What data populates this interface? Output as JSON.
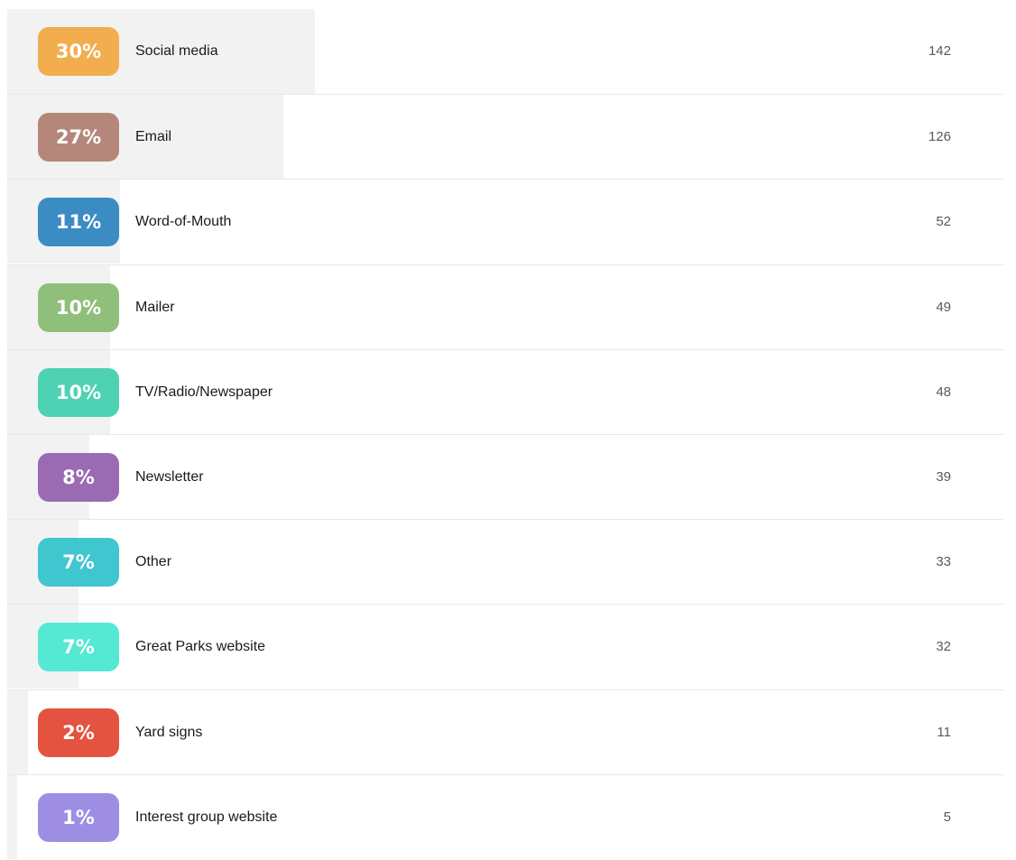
{
  "chart_data": {
    "type": "bar",
    "orientation": "horizontal",
    "categories": [
      "Social media",
      "Email",
      "Word-of-Mouth",
      "Mailer",
      "TV/Radio/Newspaper",
      "Newsletter",
      "Other",
      "Great Parks website",
      "Yard signs",
      "Interest group website"
    ],
    "percent_labels": [
      "30%",
      "27%",
      "11%",
      "10%",
      "10%",
      "8%",
      "7%",
      "7%",
      "2%",
      "1%"
    ],
    "values": [
      142,
      126,
      52,
      49,
      48,
      39,
      33,
      32,
      11,
      5
    ],
    "percentages": [
      30,
      27,
      11,
      10,
      10,
      8,
      7,
      7,
      2,
      1
    ],
    "badge_colors": [
      "#f2ad4e",
      "#b5877a",
      "#3c8cc4",
      "#8fbf7a",
      "#4fd1b3",
      "#9a6bb3",
      "#3fc6cf",
      "#55e8d2",
      "#e4533f",
      "#9d8ee3"
    ],
    "bar_color": "#f2f2f2"
  }
}
